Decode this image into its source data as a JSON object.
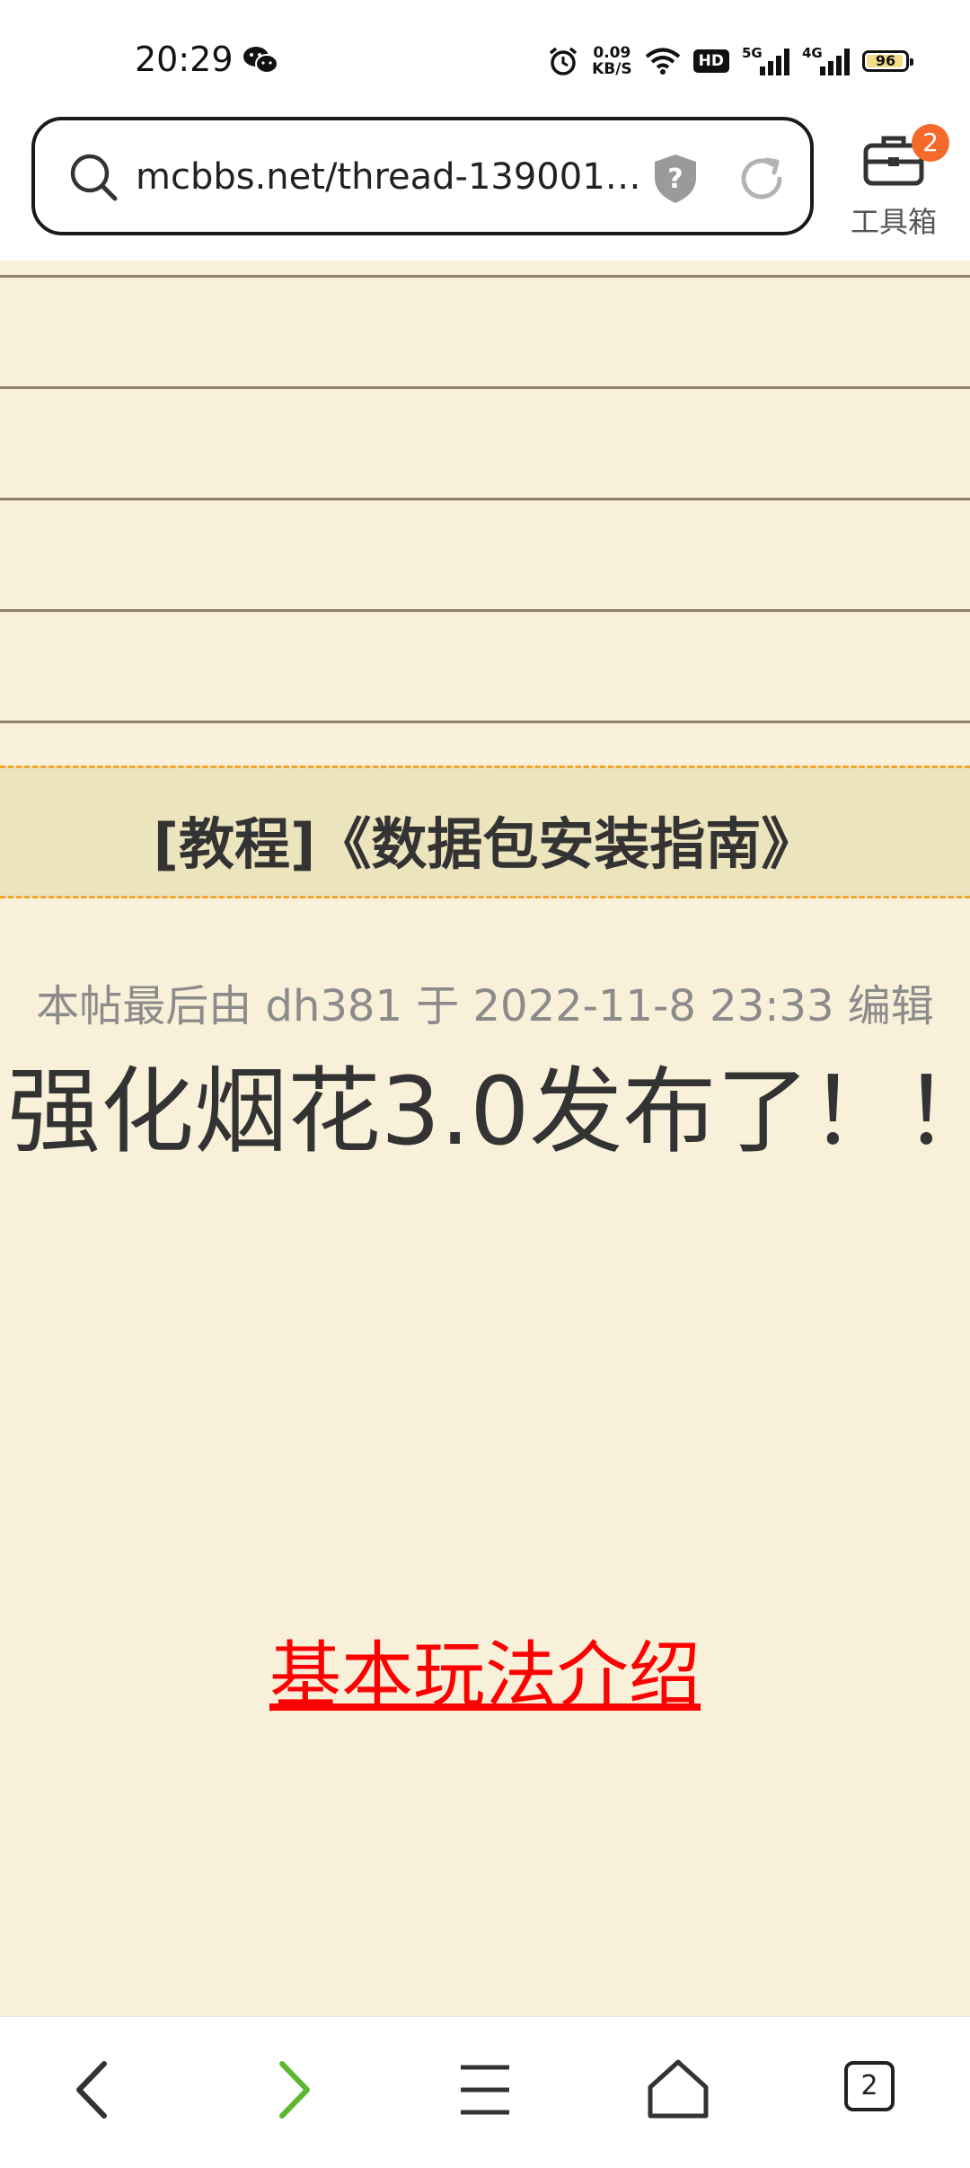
{
  "status_bar": {
    "time": "20:29",
    "net_speed_value": "0.09",
    "net_speed_unit": "KB/S",
    "hd_label": "HD",
    "signal1_label": "5G",
    "signal2_label": "4G",
    "battery_level": "96",
    "battery_fill_color": "#f3dc8a",
    "icons": [
      "wechat-icon",
      "alarm-icon",
      "wifi-icon"
    ]
  },
  "address_bar": {
    "url": "mcbbs.net/thread-139001…",
    "shield_icon": "?",
    "icons": [
      "search-icon",
      "shield-icon",
      "reload-icon"
    ]
  },
  "toolbox": {
    "label": "工具箱",
    "badge": "2",
    "badge_color": "#f56a2b"
  },
  "content": {
    "background": "#f9f0da",
    "thread_title": "[教程]《数据包安装指南》",
    "edit_note": "本帖最后由 dh381 于 2022-11-8 23:33 编辑",
    "headline": "强化烟花3.0发布了！！",
    "intro_link": "基本玩法介绍",
    "link_color": "#ff0000"
  },
  "bottom_nav": {
    "items": [
      "back-icon",
      "forward-icon",
      "menu-icon",
      "home-icon",
      "tabs-icon"
    ],
    "tab_count": "2",
    "forward_color": "#5cb82e"
  }
}
